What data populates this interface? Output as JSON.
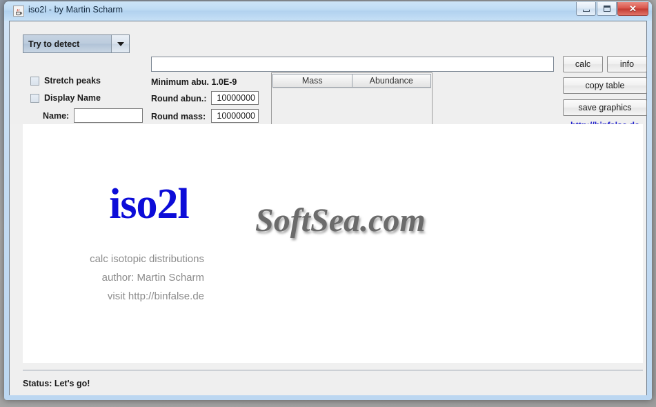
{
  "window": {
    "title": "iso2l - by Martin Scharm",
    "icon": "java-coffee-cup-icon",
    "controls": {
      "minimize": "minimize-icon",
      "maximize": "maximize-icon",
      "close": "✕"
    }
  },
  "toolbar": {
    "combo": {
      "selected": "Try to detect",
      "arrow": "chevron-down-icon"
    },
    "checkboxes": [
      {
        "label": "Stretch peaks",
        "checked": false
      },
      {
        "label": "Display Name",
        "checked": false
      }
    ],
    "name_field": {
      "label": "Name:",
      "value": "",
      "placeholder": ""
    },
    "formula_field": {
      "value": "",
      "placeholder": ""
    },
    "minimum_abundance": "Minimum abu. 1.0E-9",
    "round_abun": {
      "label": "Round abun.:",
      "value": "10000000"
    },
    "round_mass": {
      "label": "Round mass:",
      "value": "10000000"
    },
    "buttons": {
      "calc": "calc",
      "info": "info",
      "copy_table": "copy table",
      "save_graphics": "save graphics"
    },
    "link": "http://binfalse.de"
  },
  "table": {
    "columns": [
      "Mass",
      "Abundance"
    ],
    "rows": []
  },
  "canvas": {
    "logo": "iso2l",
    "lines": [
      "calc isotopic distributions",
      "author: Martin Scharm",
      "visit http://binfalse.de"
    ],
    "watermark": "SoftSea.com"
  },
  "status": {
    "text": "Status: Let's go!"
  },
  "colors": {
    "logo_blue": "#0c0cd8",
    "link_blue": "#2222cc",
    "panel_gray": "#efefef",
    "close_red": "#d9544a"
  }
}
